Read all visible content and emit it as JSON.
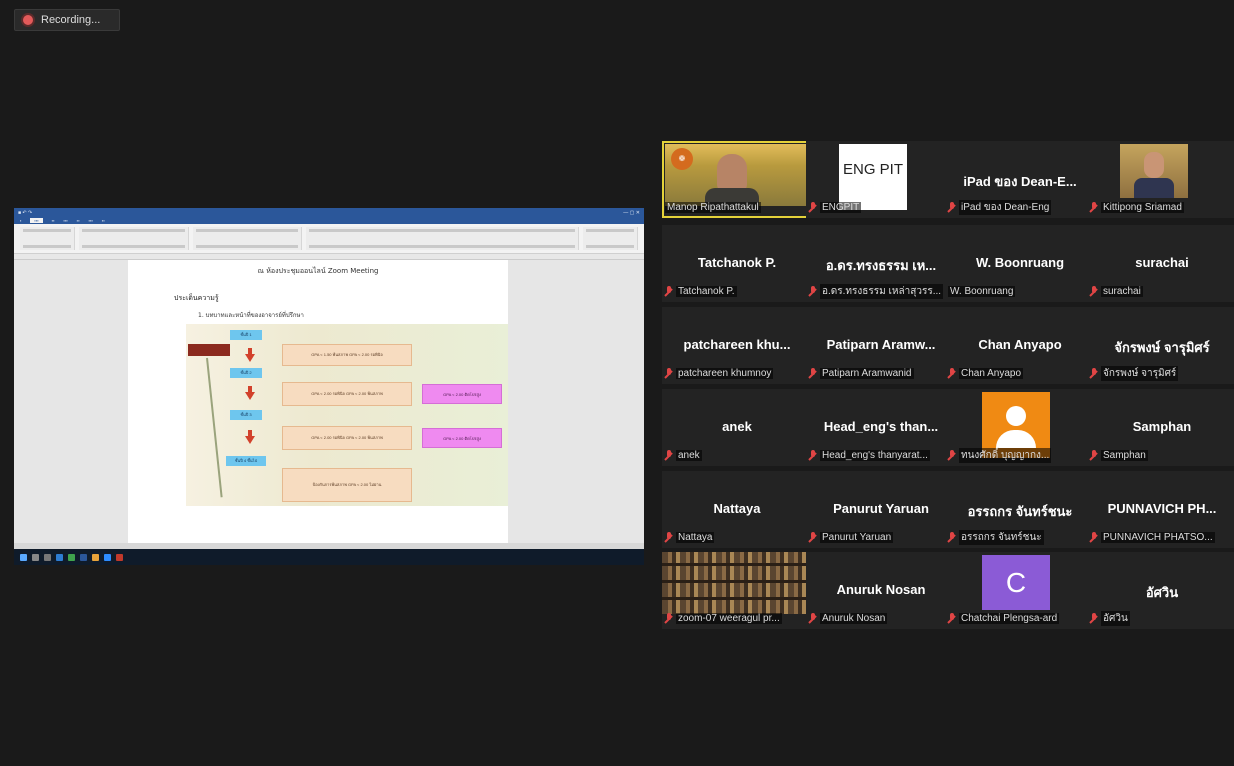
{
  "recording": {
    "label": "Recording..."
  },
  "shared_screen": {
    "doc_heading": "ณ ห้องประชุมออนไลน์ Zoom Meeting",
    "section_title": "ประเด็นความรู้",
    "list_item": "1.  บทบาทและหน้าที่ของอาจารย์ที่ปรึกษา",
    "steps": [
      "ชั้นปี 1",
      "ชั้นปี 2",
      "ชั้นปี 3",
      "ชั้นปี 4 ขึ้นไป"
    ],
    "boxes": [
      "GPA < 1.50 พ้นสภาพ GPA < 2.00 รอพินิจ",
      "GPA < 2.00 รอพินิจ GPA < 2.00 พ้นสภาพ",
      "GPA < 2.00 รอพินิจ GPA < 2.00 พ้นสภาพ",
      "ป้องกันการพ้นสภาพ GPA < 2.00 ไม่ผ่าน"
    ],
    "pink_boxes": [
      "GPA < 2.00 ติดโปรสูง",
      "GPA < 2.00 ติดโปรสูง"
    ]
  },
  "participants": [
    {
      "center": "",
      "name": "Manop Ripathattakul",
      "video": "manop",
      "active": true
    },
    {
      "center": "",
      "name": "ENGPIT",
      "video": "eng-pit",
      "logo_text": "ENG PIT"
    },
    {
      "center": "iPad ของ Dean-E...",
      "name": "iPad ของ Dean-Eng"
    },
    {
      "center": "",
      "name": "Kittipong Sriamad",
      "video": "kitti"
    },
    {
      "center": "Tatchanok P.",
      "name": "Tatchanok P."
    },
    {
      "center": "อ.ดร.ทรงธรรม เห...",
      "name": "อ.ดร.ทรงธรรม เหล่าสุวรร..."
    },
    {
      "center": "W. Boonruang",
      "name": "W. Boonruang"
    },
    {
      "center": "surachai",
      "name": "surachai"
    },
    {
      "center": "patchareen khu...",
      "name": "patchareen khumnoy"
    },
    {
      "center": "Patiparn Aramw...",
      "name": "Patiparn Aramwanid"
    },
    {
      "center": "Chan Anyapo",
      "name": "Chan Anyapo"
    },
    {
      "center": "จักรพงษ์ จารุมิศร์",
      "name": "จักรพงษ์ จารุมิศร์"
    },
    {
      "center": "anek",
      "name": "anek"
    },
    {
      "center": "Head_eng's than...",
      "name": "Head_eng's thanyarat..."
    },
    {
      "center": "",
      "name": "ทนงศักดิ์ บุญญากง...",
      "video": "avatar-orange"
    },
    {
      "center": "Samphan",
      "name": "Samphan"
    },
    {
      "center": "Nattaya",
      "name": "Nattaya"
    },
    {
      "center": "Panurut Yaruan",
      "name": "Panurut Yaruan"
    },
    {
      "center": "อรรถกร จันทร์ชนะ",
      "name": "อรรถกร จันทร์ชนะ"
    },
    {
      "center": "PUNNAVICH PH...",
      "name": "PUNNAVICH PHATSO..."
    },
    {
      "center": "",
      "name": "zoom-07 weeragul pr...",
      "video": "library"
    },
    {
      "center": "Anuruk Nosan",
      "name": "Anuruk Nosan"
    },
    {
      "center": "",
      "name": "Chatchai Plengsa-ard",
      "video": "avatar-c",
      "avatar_letter": "C"
    },
    {
      "center": "อัศวิน",
      "name": "อัศวิน"
    }
  ]
}
